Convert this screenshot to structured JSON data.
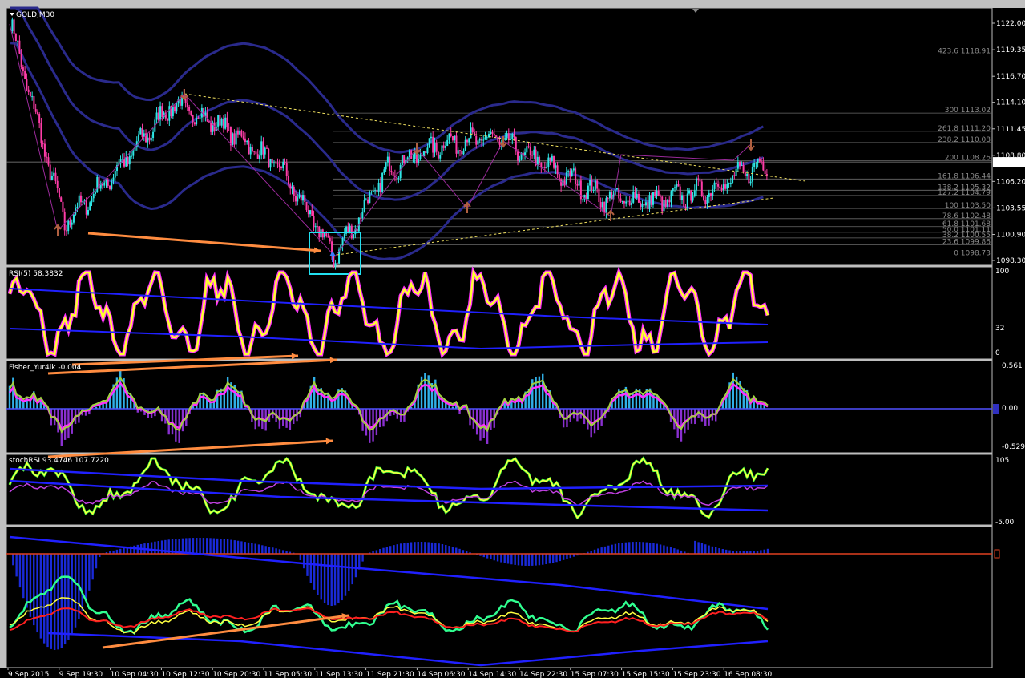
{
  "window": {
    "symbol_label": "GOLD,M30"
  },
  "colors": {
    "bg": "#000000",
    "frame": "#c0c0c0",
    "bull": "#2ee6e6",
    "bear": "#ff3ca8",
    "ma": "#2a2a8c",
    "grid": "#505050",
    "fibo": "#6a6a6a",
    "trend": "#f0e060",
    "arrow_orange": "#ff8c40",
    "highlight": "#22e0f0"
  },
  "price_axis": {
    "ticks": [
      "1122.00",
      "1119.35",
      "1116.70",
      "1114.10",
      "1111.45",
      "1108.80",
      "1106.20",
      "1103.55",
      "1100.90",
      "1098.30"
    ],
    "current": "1108.14"
  },
  "fibo_levels": [
    {
      "ratio": "423.6",
      "price": "1118.91"
    },
    {
      "ratio": "300",
      "price": "1113.02"
    },
    {
      "ratio": "261.8",
      "price": "1111.20"
    },
    {
      "ratio": "238.2",
      "price": "1110.08"
    },
    {
      "ratio": "200",
      "price": "1108.26"
    },
    {
      "ratio": "161.8",
      "price": "1106.44"
    },
    {
      "ratio": "138.2",
      "price": "1105.32"
    },
    {
      "ratio": "127.2",
      "price": "1104.79"
    },
    {
      "ratio": "100",
      "price": "1103.50"
    },
    {
      "ratio": "78.6",
      "price": "1102.48"
    },
    {
      "ratio": "61.8",
      "price": "1101.68"
    },
    {
      "ratio": "50.0",
      "price": "1101.11"
    },
    {
      "ratio": "38.2",
      "price": "1100.55"
    },
    {
      "ratio": "23.6",
      "price": "1099.86"
    },
    {
      "ratio": "0",
      "price": "1098.73"
    }
  ],
  "rsi": {
    "label": "RSI(5) 58.3832",
    "ticks": [
      "100",
      "32",
      "0"
    ]
  },
  "fisher": {
    "label": "Fisher_Yur4ik -0.004",
    "ticks": [
      "0.561",
      "0.00",
      "-0.529"
    ]
  },
  "stoch": {
    "label": "stochRSI 93.4746 107.7220",
    "ticks": [
      "105",
      "-5.00"
    ]
  },
  "time_axis": [
    "9 Sep 2015",
    "9 Sep 19:30",
    "10 Sep 04:30",
    "10 Sep 12:30",
    "10 Sep 20:30",
    "11 Sep 05:30",
    "11 Sep 13:30",
    "11 Sep 21:30",
    "14 Sep 06:30",
    "14 Sep 14:30",
    "14 Sep 22:30",
    "15 Sep 07:30",
    "15 Sep 15:30",
    "15 Sep 23:30",
    "16 Sep 08:30"
  ],
  "chart_data": {
    "type": "line",
    "x": [
      "9 Sep 2015",
      "9 Sep 19:30",
      "10 Sep 04:30",
      "10 Sep 12:30",
      "10 Sep 20:30",
      "11 Sep 05:30",
      "11 Sep 13:30",
      "11 Sep 21:30",
      "14 Sep 06:30",
      "14 Sep 14:30",
      "14 Sep 22:30",
      "15 Sep 07:30",
      "15 Sep 15:30",
      "15 Sep 23:30",
      "16 Sep 08:30"
    ],
    "series": [
      {
        "values": [
          1122.0,
          1102.0,
          1107.5,
          1114.0,
          1111.5,
          1107.5,
          1098.7,
          1107.5,
          1110.0,
          1110.5,
          1107.5,
          1104.5,
          1104.2,
          1105.5,
          1108.1
        ]
      }
    ],
    "ylim": [
      1098.3,
      1122.0
    ],
    "grid": false
  }
}
